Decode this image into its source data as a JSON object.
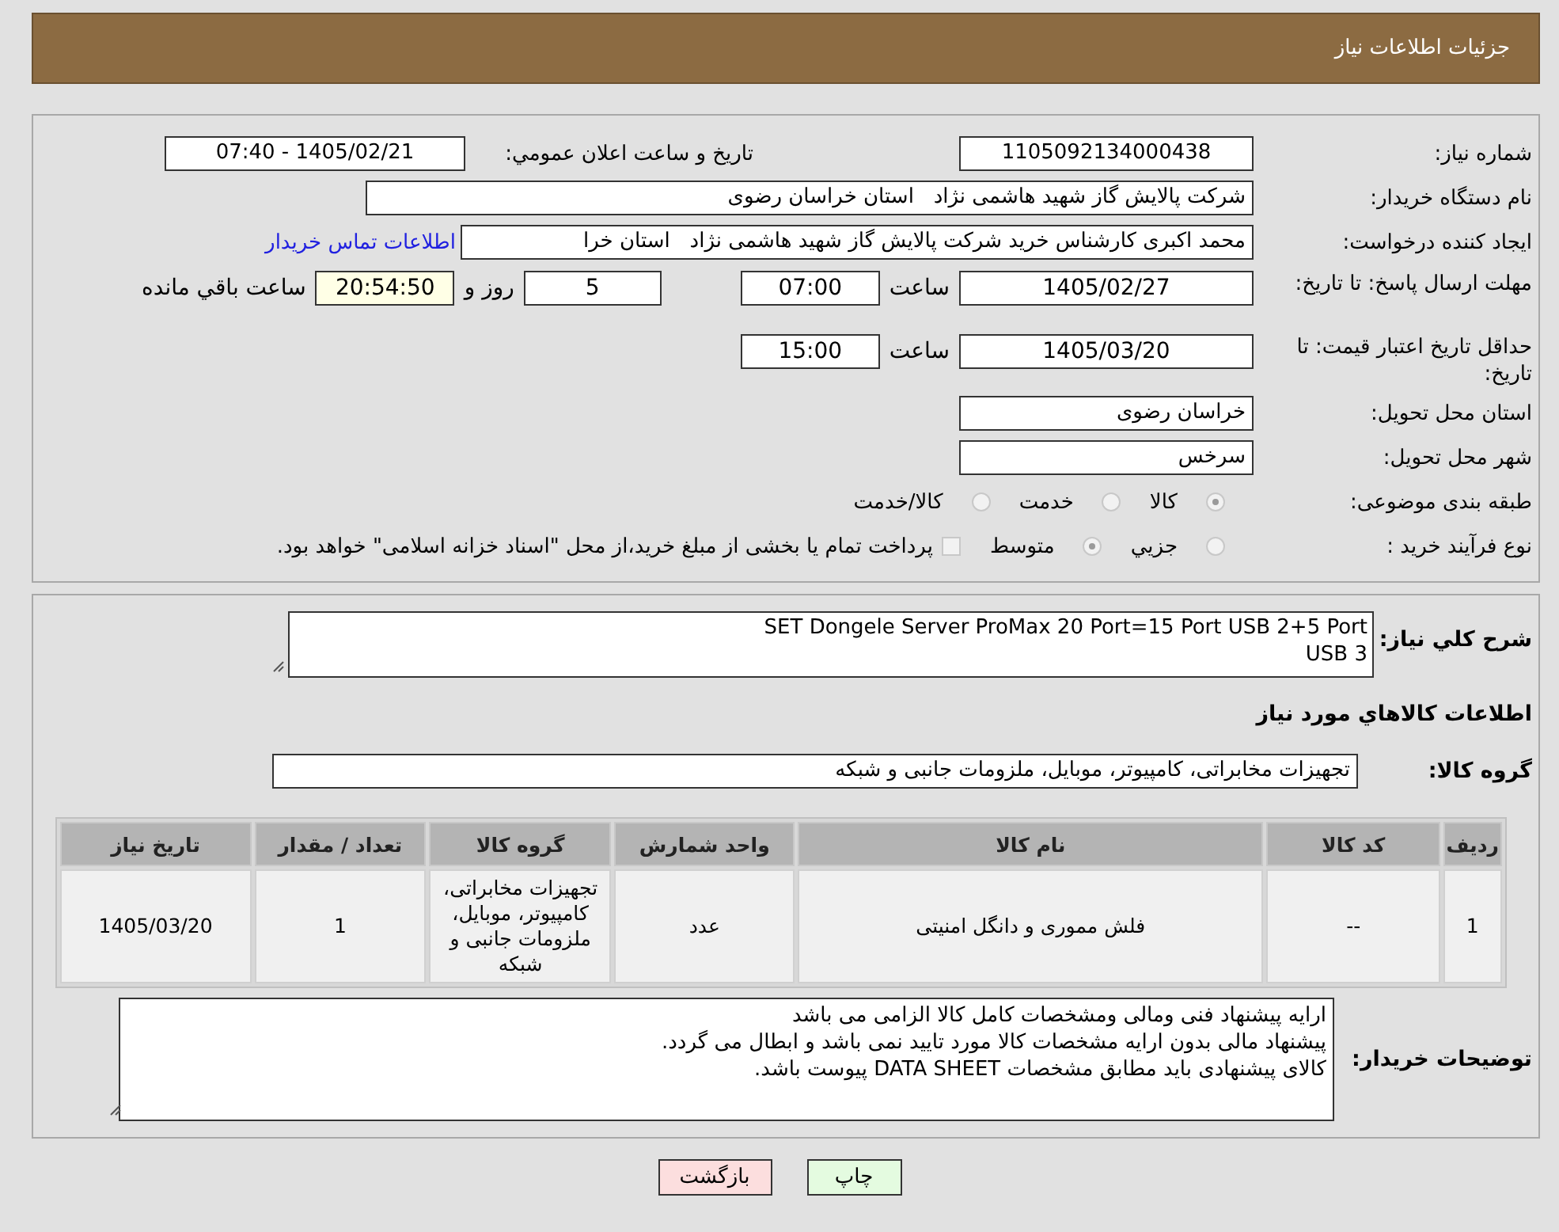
{
  "header": {
    "title": "جزئیات اطلاعات نیاز"
  },
  "need_number": {
    "label": "شماره نیاز:",
    "value": "1105092134000438"
  },
  "announce": {
    "label": "تاریخ و ساعت اعلان عمومي:",
    "value": "1405/02/21 - 07:40"
  },
  "buyer_org": {
    "label": "نام دستگاه خریدار:",
    "value": "شرکت پالایش گاز شهید هاشمی نژاد   استان خراسان رضوی"
  },
  "creator": {
    "label": "ایجاد کننده درخواست:",
    "value": "محمد اکبری کارشناس خرید شرکت پالایش گاز شهید هاشمی نژاد   استان خرا",
    "link": "اطلاعات تماس خریدار"
  },
  "reply_deadline": {
    "label": "مهلت ارسال پاسخ: تا تاریخ:",
    "date": "1405/02/27",
    "time_label": "ساعت",
    "time": "07:00",
    "days": "5",
    "days_label": "روز و",
    "remaining": "20:54:50",
    "remaining_label": "ساعت باقي مانده"
  },
  "price_validity": {
    "label": "حداقل تاریخ اعتبار قیمت: تا تاریخ:",
    "date": "1405/03/20",
    "time_label": "ساعت",
    "time": "15:00"
  },
  "delivery_province": {
    "label": "استان محل تحویل:",
    "value": "خراسان رضوی"
  },
  "delivery_city": {
    "label": "شهر محل تحویل:",
    "value": "سرخس"
  },
  "category": {
    "label": "طبقه بندی موضوعی:",
    "options": [
      {
        "label": "کالا",
        "selected": true
      },
      {
        "label": "خدمت",
        "selected": false
      },
      {
        "label": "کالا/خدمت",
        "selected": false
      }
    ]
  },
  "purchase_type": {
    "label": "نوع فرآیند خرید :",
    "options": [
      {
        "label": "جزيي",
        "selected": false
      },
      {
        "label": "متوسط",
        "selected": true
      }
    ],
    "payment_note": {
      "label": "پرداخت تمام یا بخشی از مبلغ خرید،از محل \"اسناد خزانه اسلامی\" خواهد بود.",
      "checked": false
    }
  },
  "description": {
    "label": "شرح کلي نياز:",
    "value": "SET Dongele Server ProMax 20 Port=15 Port USB 2+5 Port USB 3"
  },
  "goods_heading": "اطلاعات کالاهاي مورد نياز",
  "goods_group": {
    "label": "گروه کالا:",
    "value": "تجهیزات مخابراتی، کامپیوتر، موبایل، ملزومات جانبی و شبکه"
  },
  "table": {
    "columns": [
      "ردیف",
      "کد کالا",
      "نام کالا",
      "واحد شمارش",
      "گروه کالا",
      "تعداد / مقدار",
      "تاریخ نیاز"
    ],
    "rows": [
      [
        "1",
        "--",
        "فلش مموری و دانگل امنیتی",
        "عدد",
        "تجهیزات مخابراتی، کامپیوتر، موبایل، ملزومات جانبی و شبکه",
        "1",
        "1405/03/20"
      ]
    ]
  },
  "buyer_notes": {
    "label": "توضیحات خریدار:",
    "lines": [
      "ارایه پیشنهاد فنی ومالی ومشخصات کامل کالا الزامی می باشد",
      "پیشنهاد مالی بدون ارایه مشخصات کالا مورد تایید نمی باشد و ابطال می گردد.",
      "کالای پیشنهادی باید مطابق مشخصات DATA SHEET پیوست باشد."
    ]
  },
  "buttons": [
    {
      "label": "چاپ",
      "kind": "print"
    },
    {
      "label": "بازگشت",
      "kind": "back"
    }
  ]
}
